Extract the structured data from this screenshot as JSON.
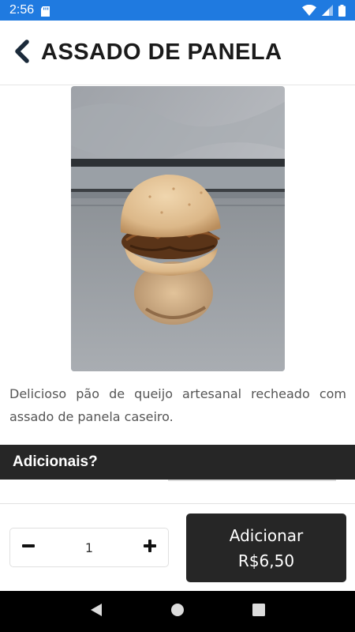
{
  "status_bar": {
    "time": "2:56",
    "icons": [
      "sd-card-icon",
      "wifi-icon",
      "signal-icon",
      "battery-icon"
    ],
    "color": "#1f7ae0"
  },
  "header": {
    "title": "ASSADO DE PANELA",
    "back_icon": "chevron-left-icon"
  },
  "product": {
    "image_description": "pão de queijo recheado com assado de panela",
    "description": "Delicioso pão de queijo artesanal recheado com assado de panela caseiro."
  },
  "addons": {
    "title": "Adicionais?"
  },
  "footer": {
    "quantity": "1",
    "decrement_icon": "minus-icon",
    "increment_icon": "plus-icon",
    "add_label": "Adicionar",
    "add_price": "R$6,50",
    "button_color": "#262626"
  },
  "nav_bar": {
    "icons": [
      "back-triangle-icon",
      "home-circle-icon",
      "recents-square-icon"
    ]
  }
}
